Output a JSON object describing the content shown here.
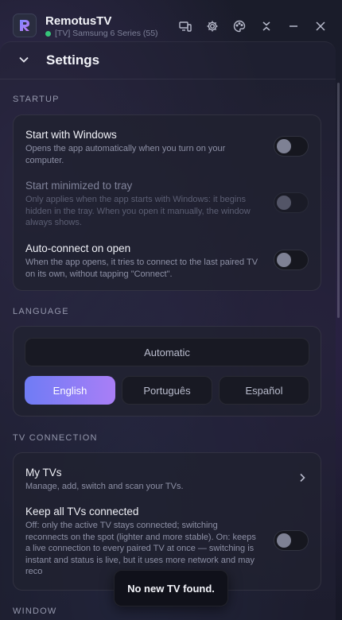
{
  "app": {
    "title": "RemotusTV",
    "status": "[TV] Samsung 6 Series (55)",
    "status_color": "#36c57a"
  },
  "titlebar_icons": [
    "devices-icon",
    "gear-icon",
    "palette-icon",
    "collapse-icon",
    "minimize-icon",
    "close-icon"
  ],
  "header": {
    "title": "Settings"
  },
  "startup": {
    "label": "STARTUP",
    "items": [
      {
        "title": "Start with Windows",
        "desc": "Opens the app automatically when you turn on your computer.",
        "enabled": true,
        "on": false
      },
      {
        "title": "Start minimized to tray",
        "desc": "Only applies when the app starts with Windows: it begins hidden in the tray. When you open it manually, the window always shows.",
        "enabled": false,
        "on": false
      },
      {
        "title": "Auto-connect on open",
        "desc": "When the app opens, it tries to connect to the last paired TV on its own, without tapping \"Connect\".",
        "enabled": true,
        "on": false
      }
    ]
  },
  "language": {
    "label": "LANGUAGE",
    "automatic": "Automatic",
    "options": [
      "English",
      "Português",
      "Español"
    ],
    "selected": "English",
    "accent_gradient": [
      "#6f7cf5",
      "#a97ef6"
    ]
  },
  "tv_connection": {
    "label": "TV CONNECTION",
    "my_tvs": {
      "title": "My TVs",
      "desc": "Manage, add, switch and scan your TVs."
    },
    "keep_connected": {
      "title": "Keep all TVs connected",
      "desc": "Off: only the active TV stays connected; switching reconnects on the spot (lighter and more stable). On: keeps a live connection to every paired TV at once — switching is instant and status is live, but it uses more network and may reco",
      "on": false
    }
  },
  "window": {
    "label": "WINDOW"
  },
  "toast": {
    "text": "No new TV found."
  }
}
